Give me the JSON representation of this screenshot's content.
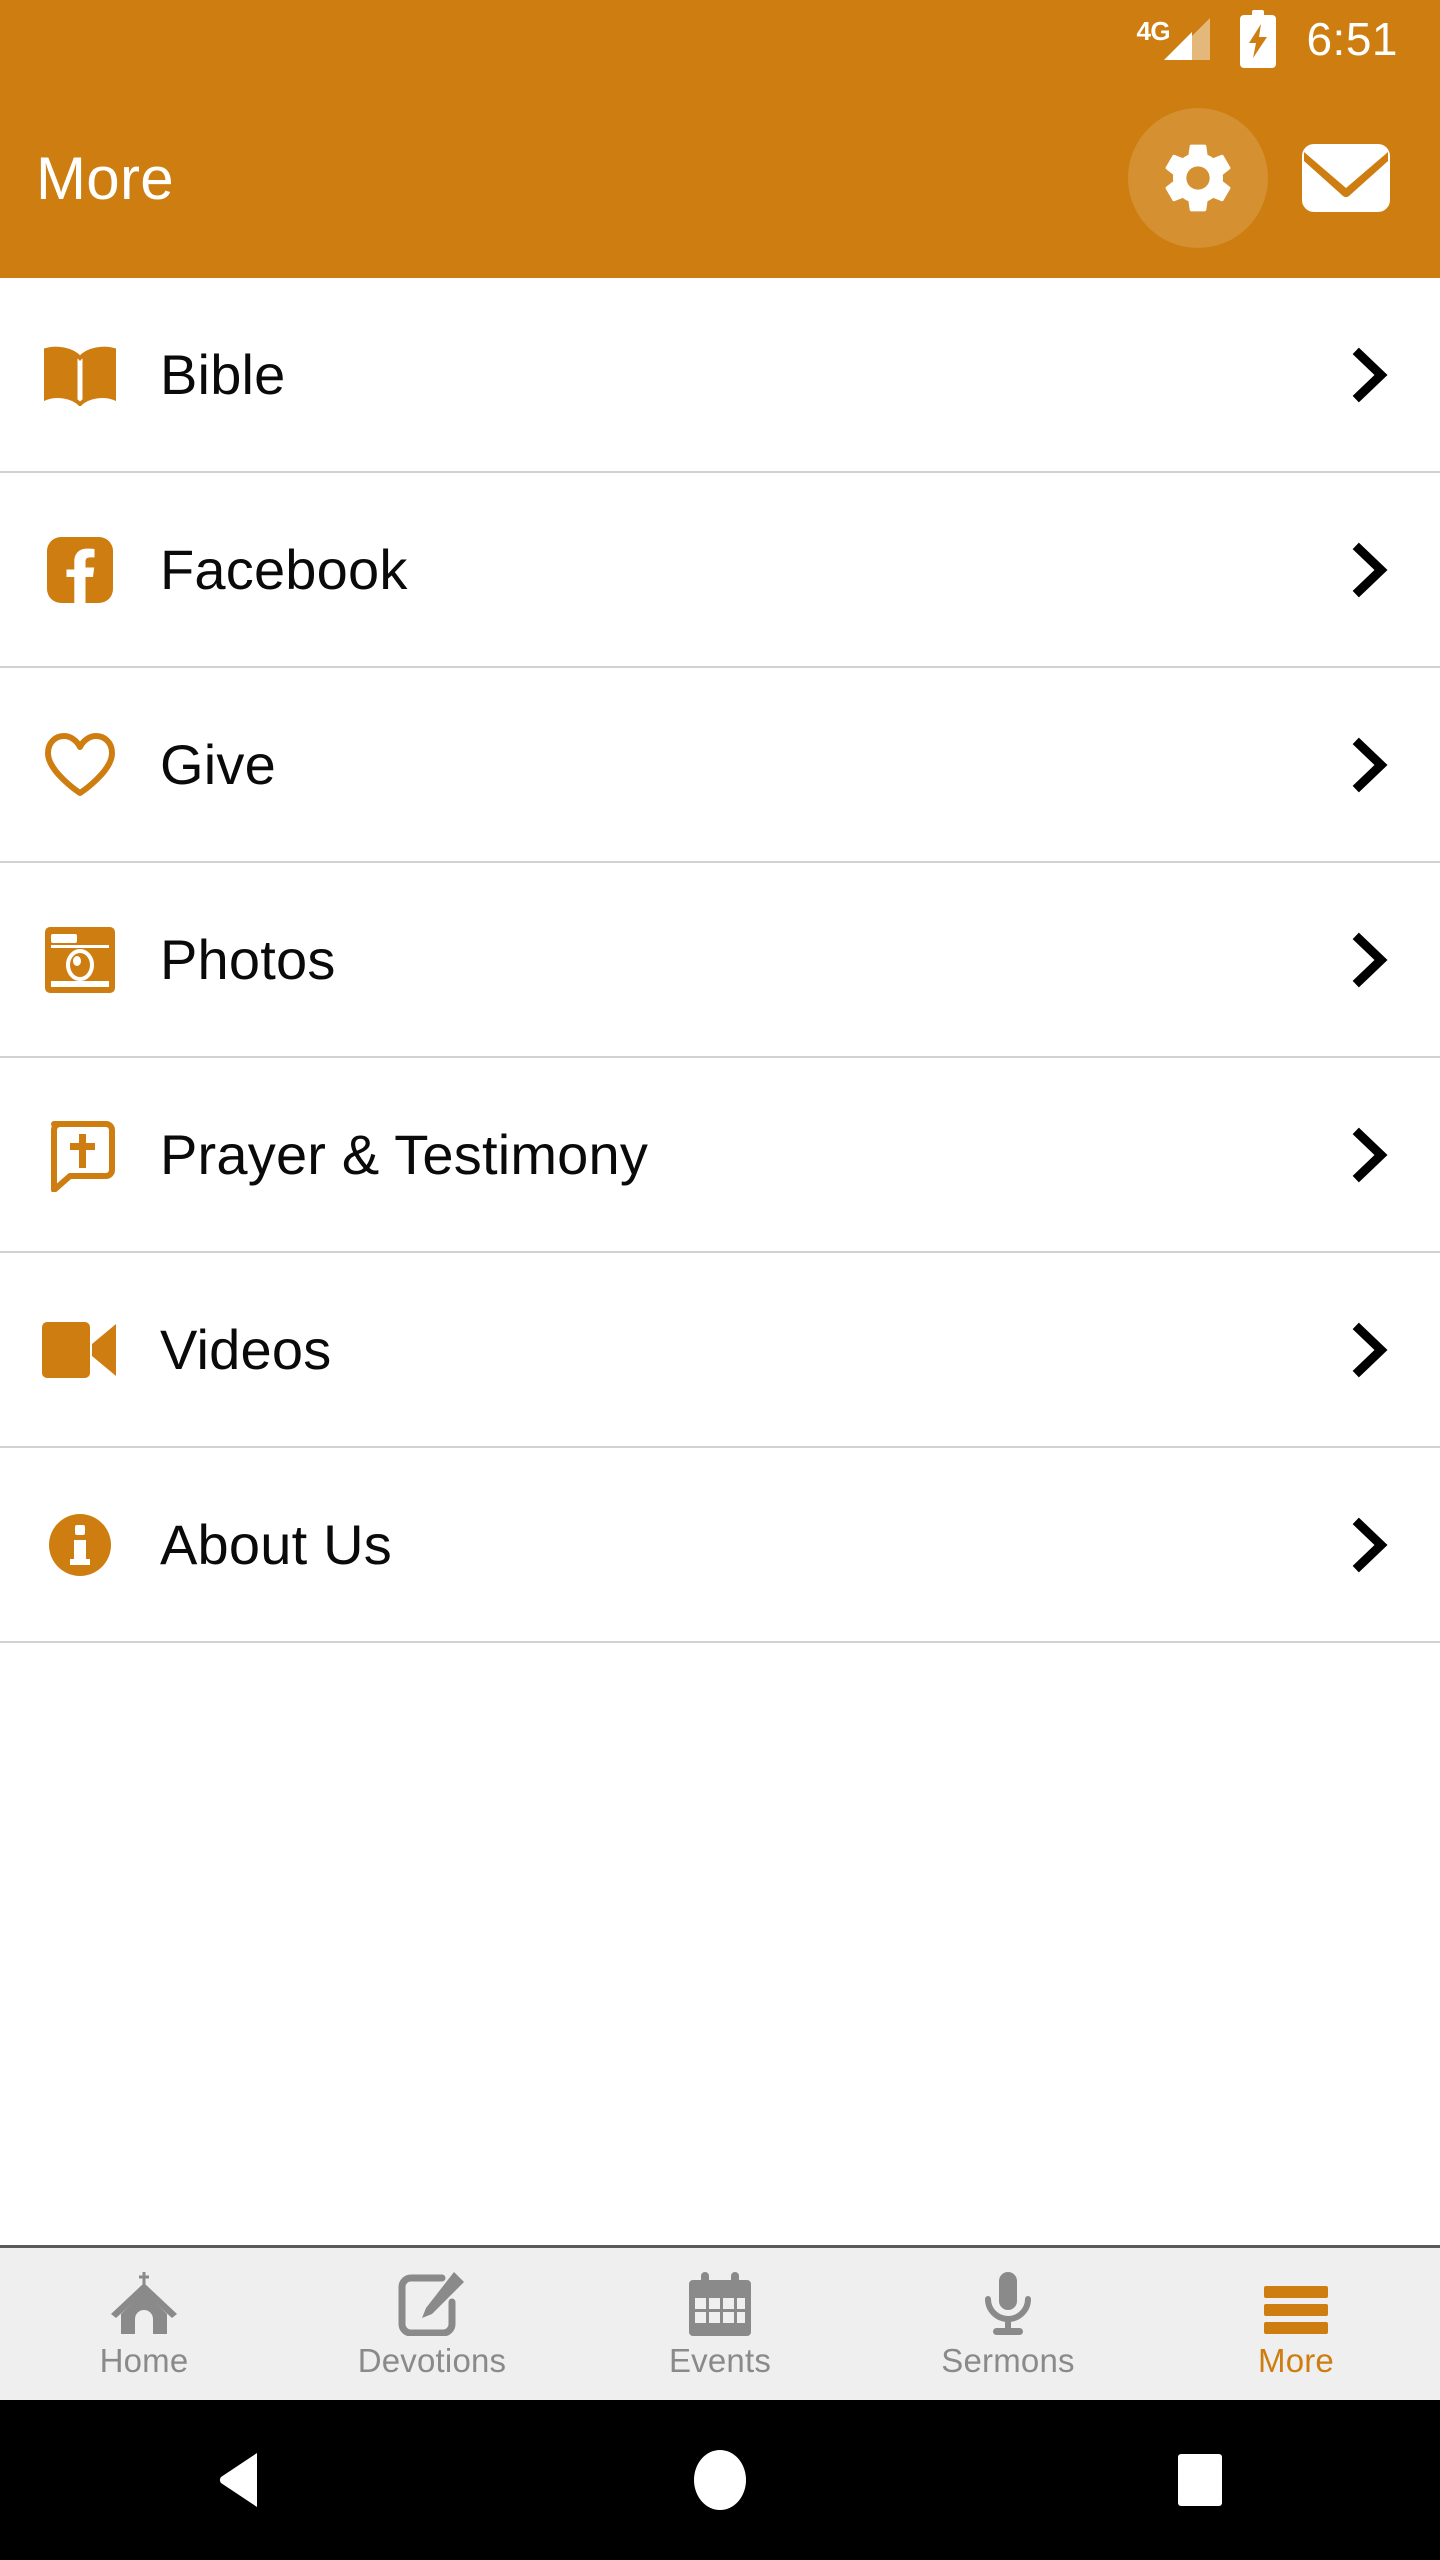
{
  "status_bar": {
    "network": "4G",
    "battery_icon": "battery-charging-icon",
    "time": "6:51"
  },
  "app_bar": {
    "title": "More",
    "actions": [
      {
        "name": "settings",
        "icon": "gear-icon",
        "label": "Settings"
      },
      {
        "name": "messages",
        "icon": "envelope-icon",
        "label": "Messages"
      }
    ]
  },
  "menu": {
    "items": [
      {
        "label": "Bible",
        "icon": "open-book-icon",
        "chevron": "chevron-right-icon"
      },
      {
        "label": "Facebook",
        "icon": "facebook-icon",
        "chevron": "chevron-right-icon"
      },
      {
        "label": "Give",
        "icon": "heart-outline-icon",
        "chevron": "chevron-right-icon"
      },
      {
        "label": "Photos",
        "icon": "camera-icon",
        "chevron": "chevron-right-icon"
      },
      {
        "label": "Prayer & Testimony",
        "icon": "speech-cross-icon",
        "chevron": "chevron-right-icon"
      },
      {
        "label": "Videos",
        "icon": "video-camera-icon",
        "chevron": "chevron-right-icon"
      },
      {
        "label": "About Us",
        "icon": "info-circle-icon",
        "chevron": "chevron-right-icon"
      }
    ]
  },
  "bottom_nav": {
    "tabs": [
      {
        "label": "Home",
        "icon": "church-icon",
        "active": false
      },
      {
        "label": "Devotions",
        "icon": "note-pencil-icon",
        "active": false
      },
      {
        "label": "Events",
        "icon": "calendar-icon",
        "active": false
      },
      {
        "label": "Sermons",
        "icon": "microphone-icon",
        "active": false
      },
      {
        "label": "More",
        "icon": "hamburger-icon",
        "active": true
      }
    ]
  },
  "system_nav": {
    "buttons": [
      {
        "name": "back",
        "icon": "triangle-back-icon"
      },
      {
        "name": "home",
        "icon": "circle-home-icon"
      },
      {
        "name": "recents",
        "icon": "square-recents-icon"
      }
    ]
  },
  "colors": {
    "brand_orange": "#CE7E10",
    "appbar_text": "#FFFFFF",
    "list_text": "#0A0A0A",
    "divider": "#D2D2D2",
    "tab_inactive": "#8A8A8A",
    "tabbar_bg": "#EFEFEF",
    "sysnav_bg": "#000000"
  }
}
